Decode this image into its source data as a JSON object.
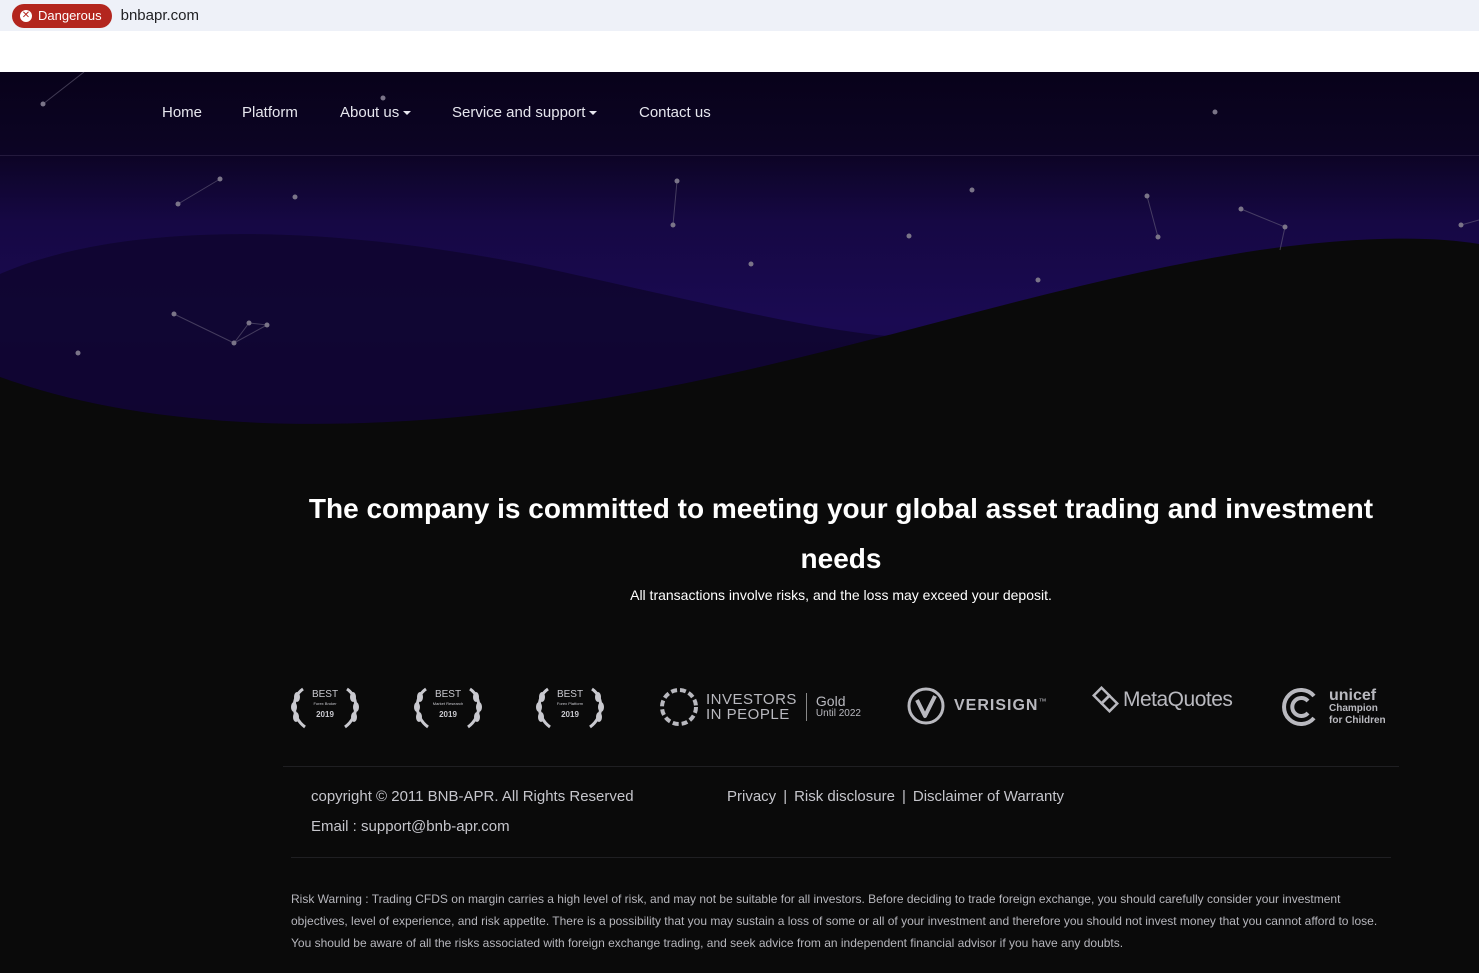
{
  "browser": {
    "danger_label": "Dangerous",
    "url": "bnbapr.com"
  },
  "nav": {
    "items": [
      {
        "label": "Home",
        "dropdown": false
      },
      {
        "label": "Platform",
        "dropdown": false
      },
      {
        "label": "About us",
        "dropdown": true
      },
      {
        "label": "Service and support",
        "dropdown": true
      },
      {
        "label": "Contact us",
        "dropdown": false
      }
    ]
  },
  "hero": {
    "headline": "The company is committed to meeting your global asset trading and investment needs",
    "subline": "All transactions involve risks, and the loss may exceed your deposit."
  },
  "logos": {
    "awards": [
      {
        "title": "BEST",
        "sub": "Forex Broker",
        "year": "2019"
      },
      {
        "title": "BEST",
        "sub": "Market Research",
        "year": "2019"
      },
      {
        "title": "BEST",
        "sub": "Forex Platform",
        "year": "2019"
      }
    ],
    "iip": {
      "line1": "INVESTORS",
      "line2": "IN PEOPLE",
      "gold": "Gold",
      "until": "Until 2022"
    },
    "verisign": "VERISIGN",
    "verisign_tm": "™",
    "metaquotes": "MetaQuotes",
    "unicef": {
      "name": "unicef",
      "line1": "Champion",
      "line2": "for Children"
    }
  },
  "footer": {
    "copyright": "copyright © 2011 BNB-APR. All Rights Reserved",
    "email": "Email : support@bnb-apr.com",
    "links": [
      "Privacy",
      "Risk disclosure",
      "Disclaimer of Warranty"
    ],
    "separator": "|",
    "risk_warning": "Risk Warning : Trading CFDS on margin carries a high level of risk, and may not be suitable for all investors. Before deciding to trade foreign exchange, you should carefully consider your investment objectives, level of experience, and risk appetite. There is a possibility that you may sustain a loss of some or all of your investment and therefore you should not invest money that you cannot afford to lose. You should be aware of all the risks associated with foreign exchange trading, and seek advice from an independent financial advisor if you have any doubts."
  },
  "colors": {
    "danger": "#b3261e",
    "hero_purple": "#1a0a52",
    "page_black": "#0a0a0a",
    "text_gray": "#c6c6cc"
  }
}
